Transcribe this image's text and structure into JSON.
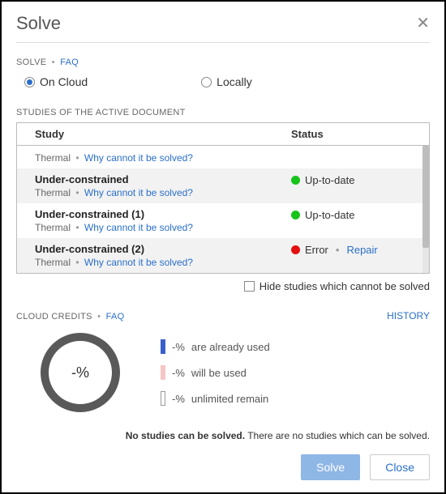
{
  "dialog": {
    "title": "Solve"
  },
  "solve_section": {
    "label": "SOLVE",
    "faq": "FAQ",
    "options": {
      "cloud": "On Cloud",
      "local": "Locally"
    }
  },
  "studies_section": {
    "label": "STUDIES OF THE ACTIVE DOCUMENT",
    "col_study": "Study",
    "col_status": "Status",
    "rows": [
      {
        "title": "",
        "type": "Thermal",
        "why": "Why cannot it be solved?",
        "status": "",
        "dot": ""
      },
      {
        "title": "Under-constrained",
        "type": "Thermal",
        "why": "Why cannot it be solved?",
        "status": "Up-to-date",
        "dot": "green"
      },
      {
        "title": "Under-constrained  (1)",
        "type": "Thermal",
        "why": "Why cannot it be solved?",
        "status": "Up-to-date",
        "dot": "green"
      },
      {
        "title": "Under-constrained  (2)",
        "type": "Thermal",
        "why": "Why cannot it be solved?",
        "status": "Error",
        "dot": "red",
        "repair": "Repair"
      }
    ],
    "hide_label": "Hide studies which cannot be solved"
  },
  "credits_section": {
    "label": "CLOUD CREDITS",
    "faq": "FAQ",
    "history": "HISTORY",
    "ring_value": "-%",
    "legend": {
      "used_pct": "-%",
      "used_txt": "are already used",
      "willbe_pct": "-%",
      "willbe_txt": "will be used",
      "remain_pct": "-%",
      "remain_txt": "unlimited remain"
    }
  },
  "footer": {
    "bold": "No studies can be solved.",
    "rest": " There are no studies which can be solved.",
    "solve_btn": "Solve",
    "close_btn": "Close"
  }
}
